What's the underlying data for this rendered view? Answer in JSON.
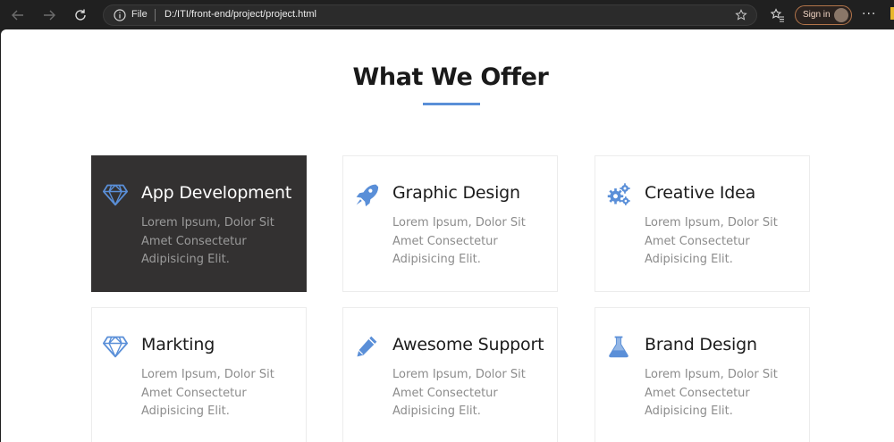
{
  "browser": {
    "address_scheme": "File",
    "url": "D:/ITI/front-end/project/project.html",
    "signin_label": "Sign in",
    "more_label": "···"
  },
  "section": {
    "title": "What We Offer",
    "accent_color": "#5a8fd8"
  },
  "services": [
    {
      "icon": "diamond-icon",
      "title": "App Development",
      "text": "Lorem Ipsum, Dolor Sit Amet Consectetur Adipisicing Elit.",
      "active": true
    },
    {
      "icon": "rocket-icon",
      "title": "Graphic Design",
      "text": "Lorem Ipsum, Dolor Sit Amet Consectetur Adipisicing Elit.",
      "active": false
    },
    {
      "icon": "gears-icon",
      "title": "Creative Idea",
      "text": "Lorem Ipsum, Dolor Sit Amet Consectetur Adipisicing Elit.",
      "active": false
    },
    {
      "icon": "diamond-icon",
      "title": "Markting",
      "text": "Lorem Ipsum, Dolor Sit Amet Consectetur Adipisicing Elit.",
      "active": false
    },
    {
      "icon": "pencil-icon",
      "title": "Awesome Support",
      "text": "Lorem Ipsum, Dolor Sit Amet Consectetur Adipisicing Elit.",
      "active": false
    },
    {
      "icon": "flask-icon",
      "title": "Brand Design",
      "text": "Lorem Ipsum, Dolor Sit Amet Consectetur Adipisicing Elit.",
      "active": false
    }
  ]
}
